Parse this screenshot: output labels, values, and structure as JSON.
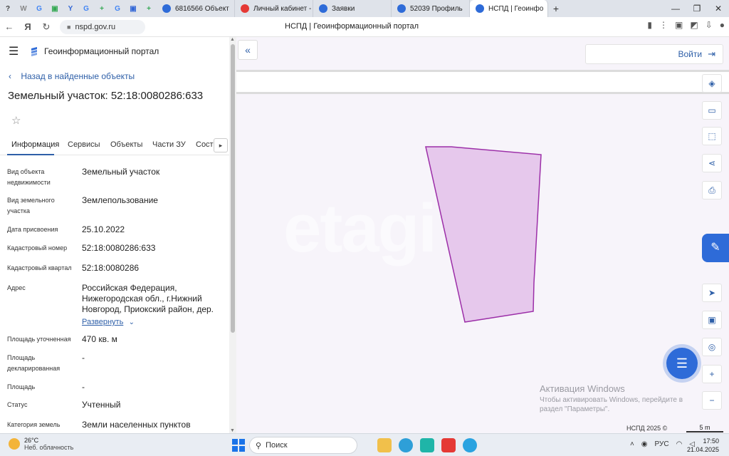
{
  "browser": {
    "mini_tabs": [
      "?",
      "W",
      "G",
      "▣",
      "Y",
      "G",
      "+",
      "G",
      "▣",
      "+"
    ],
    "tabs": [
      {
        "label": "6816566 Объект",
        "color": "#2e6bd8",
        "active": false
      },
      {
        "label": "Личный кабинет - С",
        "color": "#e53935",
        "active": false
      },
      {
        "label": "Заявки",
        "color": "#2e6bd8",
        "active": false
      },
      {
        "label": "52039 Профиль",
        "color": "#2e6bd8",
        "active": false
      },
      {
        "label": "НСПД | Геоинфо",
        "color": "#2e6bd8",
        "active": true
      }
    ],
    "new_tab": "+",
    "url": "nspd.gov.ru",
    "page_title": "НСПД | Геоинформационный портал"
  },
  "panel": {
    "header_title": "Геоинформационный портал",
    "back_link": "Назад в найденные объекты",
    "object_title": "Земельный участок: 52:18:0080286:633",
    "tabs": [
      "Информация",
      "Сервисы",
      "Объекты",
      "Части ЗУ",
      "Соста"
    ],
    "rows": [
      {
        "label": "Вид объекта недвижимости",
        "value": "Земельный участок"
      },
      {
        "label": "Вид земельного участка",
        "value": "Землепользование"
      },
      {
        "label": "Дата присвоения",
        "value": "25.10.2022"
      },
      {
        "label": "Кадастровый номер",
        "value": "52:18:0080286:633"
      },
      {
        "label": "Кадастровый квартал",
        "value": "52:18:0080286"
      },
      {
        "label": "Адрес",
        "value": "Российская Федерация, Нижегородская обл., г.Нижний Новгород, Приокский район, дер."
      },
      {
        "label": "Площадь уточненная",
        "value": "470 кв. м"
      },
      {
        "label": "Площадь декларированная",
        "value": "-"
      },
      {
        "label": "Площадь",
        "value": "-"
      },
      {
        "label": "Статус",
        "value": "Учтенный"
      },
      {
        "label": "Категория земель",
        "value": "Земли населенных пунктов"
      }
    ],
    "expand_label": "Развернуть"
  },
  "map": {
    "login_label": "Войти",
    "watermark": "etagi",
    "parcel_fill": "#e6c8ec",
    "parcel_stroke": "#9c2fa8",
    "activation_title": "Активация Windows",
    "activation_text": "Чтобы активировать Windows, перейдите в раздел \"Параметры\".",
    "footer_label": "НСПД 2025 ©",
    "scale_label": "5 m"
  },
  "taskbar": {
    "temperature": "26°C",
    "weather": "Неб. облачность",
    "search_placeholder": "Поиск",
    "language": "РУС",
    "time": "17:50",
    "date": "21.04.2025"
  },
  "colors": {
    "accent": "#2e5fa8",
    "button_blue": "#2e6bd8"
  }
}
